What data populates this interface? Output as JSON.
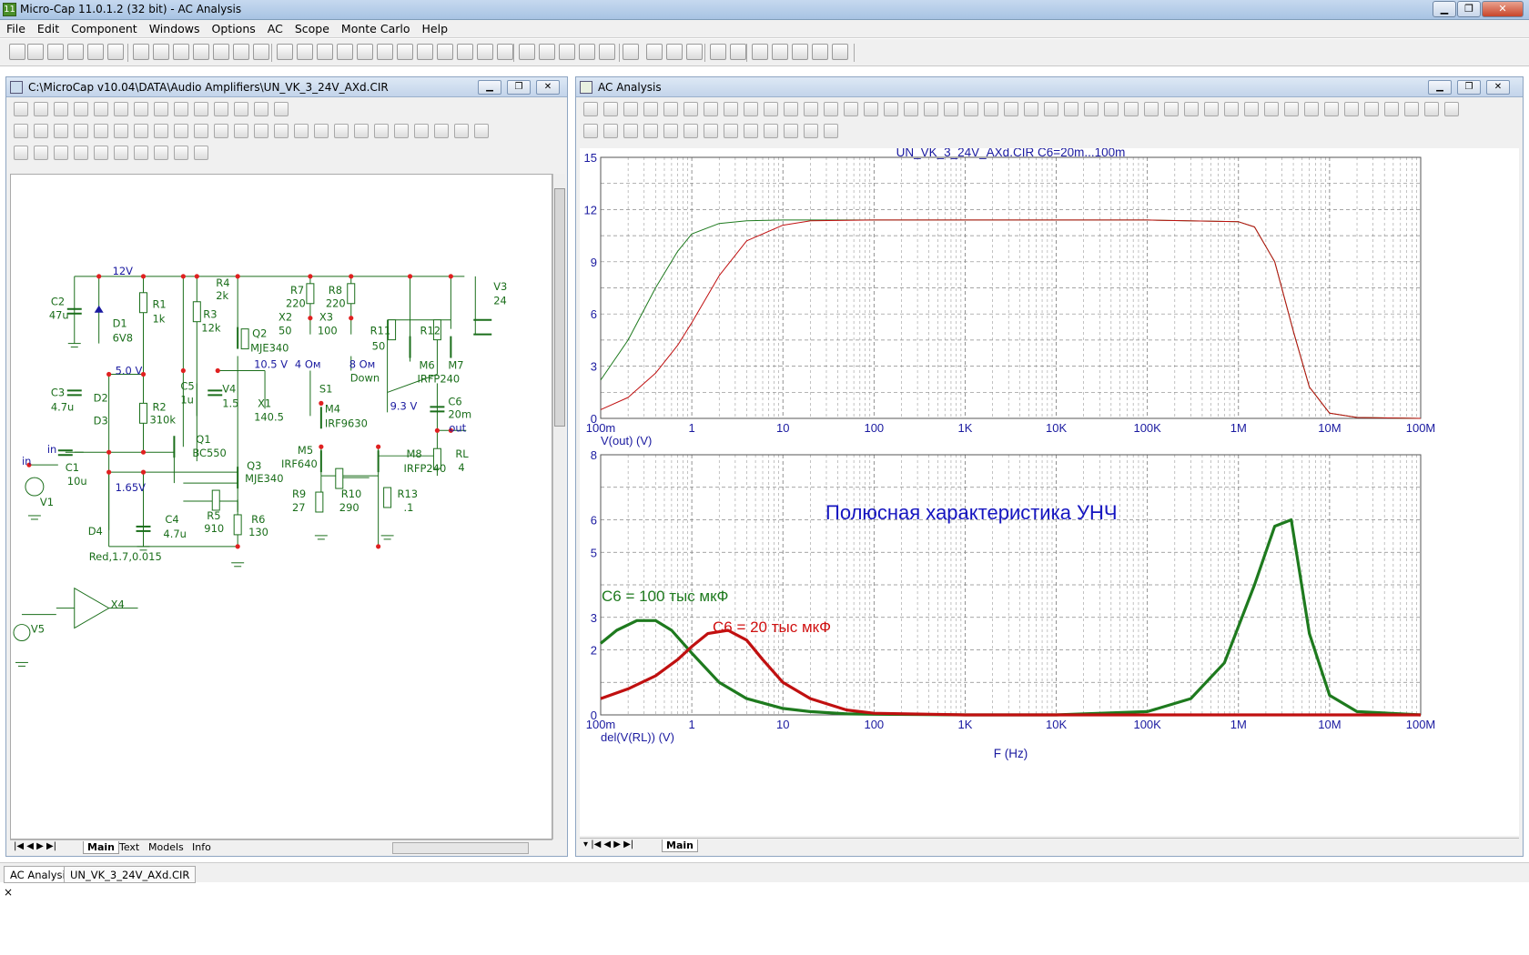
{
  "app": {
    "title": "Micro-Cap 11.0.1.2 (32 bit) - AC Analysis",
    "icon_label": "11"
  },
  "menu": [
    "File",
    "Edit",
    "Component",
    "Windows",
    "Options",
    "AC",
    "Scope",
    "Monte Carlo",
    "Help"
  ],
  "schematic": {
    "title": "C:\\MicroCap v10.04\\DATA\\Audio Amplifiers\\UN_VK_3_24V_AXd.CIR",
    "tabs": [
      "Main",
      "Text",
      "Models",
      "Info"
    ],
    "labels": [
      {
        "t": "12V",
        "c": "#1a1aa0"
      },
      {
        "t": "C2",
        "c": "#1a6e1a"
      },
      {
        "t": "47u",
        "c": "#1a6e1a"
      },
      {
        "t": "D1",
        "c": "#1a6e1a"
      },
      {
        "t": "6V8",
        "c": "#1a6e1a"
      },
      {
        "t": "R1",
        "c": "#1a6e1a"
      },
      {
        "t": "1k",
        "c": "#1a6e1a"
      },
      {
        "t": "R4",
        "c": "#1a6e1a"
      },
      {
        "t": "2k",
        "c": "#1a6e1a"
      },
      {
        "t": "R3",
        "c": "#1a6e1a"
      },
      {
        "t": "12k",
        "c": "#1a6e1a"
      },
      {
        "t": "Q2",
        "c": "#1a6e1a"
      },
      {
        "t": "MJE340",
        "c": "#1a6e1a"
      },
      {
        "t": "R7",
        "c": "#1a6e1a"
      },
      {
        "t": "220",
        "c": "#1a6e1a"
      },
      {
        "t": "R8",
        "c": "#1a6e1a"
      },
      {
        "t": "220",
        "c": "#1a6e1a"
      },
      {
        "t": "X2",
        "c": "#1a6e1a"
      },
      {
        "t": "50",
        "c": "#1a6e1a"
      },
      {
        "t": "X3",
        "c": "#1a6e1a"
      },
      {
        "t": "100",
        "c": "#1a6e1a"
      },
      {
        "t": "R11",
        "c": "#1a6e1a"
      },
      {
        "t": "50",
        "c": "#1a6e1a"
      },
      {
        "t": "R12",
        "c": "#1a6e1a"
      },
      {
        "t": "M6",
        "c": "#1a6e1a"
      },
      {
        "t": "M7",
        "c": "#1a6e1a"
      },
      {
        "t": "IRFP240",
        "c": "#1a6e1a"
      },
      {
        "t": "V3",
        "c": "#1a6e1a"
      },
      {
        "t": "24",
        "c": "#1a6e1a"
      },
      {
        "t": "5.0 V",
        "c": "#1a1aa0"
      },
      {
        "t": "10.5 V",
        "c": "#1a1aa0"
      },
      {
        "t": "4 Ом",
        "c": "#1a1aa0"
      },
      {
        "t": "8 Ом",
        "c": "#1a1aa0"
      },
      {
        "t": "Down",
        "c": "#1a6e1a"
      },
      {
        "t": "S1",
        "c": "#1a6e1a"
      },
      {
        "t": "C3",
        "c": "#1a6e1a"
      },
      {
        "t": "4.7u",
        "c": "#1a6e1a"
      },
      {
        "t": "D2",
        "c": "#1a6e1a"
      },
      {
        "t": "D3",
        "c": "#1a6e1a"
      },
      {
        "t": "R2",
        "c": "#1a6e1a"
      },
      {
        "t": "310k",
        "c": "#1a6e1a"
      },
      {
        "t": "C5",
        "c": "#1a6e1a"
      },
      {
        "t": "1u",
        "c": "#1a6e1a"
      },
      {
        "t": "V4",
        "c": "#1a6e1a"
      },
      {
        "t": "1.5",
        "c": "#1a6e1a"
      },
      {
        "t": "X1",
        "c": "#1a6e1a"
      },
      {
        "t": "140.5",
        "c": "#1a6e1a"
      },
      {
        "t": "M4",
        "c": "#1a6e1a"
      },
      {
        "t": "IRF9630",
        "c": "#1a6e1a"
      },
      {
        "t": "9.3 V",
        "c": "#1a1aa0"
      },
      {
        "t": "C6",
        "c": "#1a6e1a"
      },
      {
        "t": "20m",
        "c": "#1a6e1a"
      },
      {
        "t": "out",
        "c": "#1a1aa0"
      },
      {
        "t": "in",
        "c": "#1a1aa0"
      },
      {
        "t": "Q1",
        "c": "#1a6e1a"
      },
      {
        "t": "BC550",
        "c": "#1a6e1a"
      },
      {
        "t": "C1",
        "c": "#1a6e1a"
      },
      {
        "t": "10u",
        "c": "#1a6e1a"
      },
      {
        "t": "in",
        "c": "#1a1aa0"
      },
      {
        "t": "M5",
        "c": "#1a6e1a"
      },
      {
        "t": "IRF640",
        "c": "#1a6e1a"
      },
      {
        "t": "M8",
        "c": "#1a6e1a"
      },
      {
        "t": "IRFP240",
        "c": "#1a6e1a"
      },
      {
        "t": "RL",
        "c": "#1a6e1a"
      },
      {
        "t": "4",
        "c": "#1a6e1a"
      },
      {
        "t": "Q3",
        "c": "#1a6e1a"
      },
      {
        "t": "MJE340",
        "c": "#1a6e1a"
      },
      {
        "t": "1.65V",
        "c": "#1a1aa0"
      },
      {
        "t": "V1",
        "c": "#1a6e1a"
      },
      {
        "t": "R9",
        "c": "#1a6e1a"
      },
      {
        "t": "27",
        "c": "#1a6e1a"
      },
      {
        "t": "R10",
        "c": "#1a6e1a"
      },
      {
        "t": "290",
        "c": "#1a6e1a"
      },
      {
        "t": "R13",
        "c": "#1a6e1a"
      },
      {
        "t": ".1",
        "c": "#1a6e1a"
      },
      {
        "t": "R5",
        "c": "#1a6e1a"
      },
      {
        "t": "910",
        "c": "#1a6e1a"
      },
      {
        "t": "R6",
        "c": "#1a6e1a"
      },
      {
        "t": "130",
        "c": "#1a6e1a"
      },
      {
        "t": "D4",
        "c": "#1a6e1a"
      },
      {
        "t": "C4",
        "c": "#1a6e1a"
      },
      {
        "t": "4.7u",
        "c": "#1a6e1a"
      },
      {
        "t": "Red,1.7,0.015",
        "c": "#1a6e1a"
      },
      {
        "t": "X4",
        "c": "#1a6e1a"
      },
      {
        "t": "V5",
        "c": "#1a6e1a"
      }
    ]
  },
  "analysis": {
    "title": "AC Analysis",
    "tab": "Main",
    "colors": {
      "green": "#1e7a1e",
      "red": "#c01010",
      "axis": "#1a1aa0"
    }
  },
  "chart_data": [
    {
      "type": "line",
      "title": "UN_VK_3_24V_AXd.CIR C6=20m...100m",
      "xlabel": "",
      "ylabel": "V(out) (V)",
      "x_scale": "log",
      "xlim": [
        0.1,
        100000000
      ],
      "ylim": [
        0,
        15
      ],
      "x_ticks": [
        "100m",
        "1",
        "10",
        "100",
        "1K",
        "10K",
        "100K",
        "1M",
        "10M",
        "100M"
      ],
      "y_ticks": [
        "0",
        "3",
        "6",
        "9",
        "12",
        "15"
      ],
      "grid": true,
      "series": [
        {
          "color": "#1e7a1e",
          "x": [
            0.1,
            0.2,
            0.4,
            0.7,
            1,
            2,
            4,
            10,
            20,
            100,
            1000,
            100000,
            1000000,
            1500000,
            2500000,
            4000000,
            6000000,
            10000000,
            20000000,
            100000000
          ],
          "values": [
            2.2,
            4.5,
            7.5,
            9.6,
            10.6,
            11.2,
            11.35,
            11.4,
            11.4,
            11.4,
            11.4,
            11.4,
            11.3,
            11.0,
            9.0,
            5.0,
            1.8,
            0.3,
            0.05,
            0
          ]
        },
        {
          "color": "#c01010",
          "x": [
            0.1,
            0.2,
            0.4,
            0.7,
            1,
            2,
            4,
            10,
            20,
            100,
            1000,
            100000,
            1000000,
            1500000,
            2500000,
            4000000,
            6000000,
            10000000,
            20000000,
            100000000
          ],
          "values": [
            0.5,
            1.2,
            2.6,
            4.2,
            5.5,
            8.2,
            10.2,
            11.1,
            11.35,
            11.4,
            11.4,
            11.4,
            11.3,
            11.0,
            9.0,
            5.0,
            1.8,
            0.3,
            0.05,
            0
          ]
        }
      ]
    },
    {
      "type": "line",
      "title": "",
      "xlabel": "F (Hz)",
      "ylabel": "del(V(RL)) (V)",
      "x_scale": "log",
      "xlim": [
        0.1,
        100000000
      ],
      "ylim": [
        0,
        8
      ],
      "x_ticks": [
        "100m",
        "1",
        "10",
        "100",
        "1K",
        "10K",
        "100K",
        "1M",
        "10M",
        "100M"
      ],
      "y_ticks": [
        "0",
        "2",
        "3",
        "5",
        "6",
        "8"
      ],
      "grid": true,
      "annotations": [
        {
          "text": "Полюсная характеристика УНЧ",
          "color": "#1515c0"
        },
        {
          "text": "C6 = 100 тыс мкФ",
          "color": "#1e7a1e"
        },
        {
          "text": "C6 = 20 тыс мкФ",
          "color": "#d01010"
        }
      ],
      "series": [
        {
          "color": "#1e7a1e",
          "x": [
            0.1,
            0.15,
            0.25,
            0.4,
            0.6,
            1,
            2,
            4,
            10,
            20,
            50,
            100,
            1000,
            10000,
            100000,
            300000,
            700000,
            1500000,
            2500000,
            3800000,
            6000000,
            10000000,
            20000000,
            100000000
          ],
          "values": [
            2.2,
            2.6,
            2.9,
            2.9,
            2.6,
            1.9,
            1.0,
            0.5,
            0.2,
            0.1,
            0.03,
            0.02,
            0,
            0,
            0.1,
            0.5,
            1.6,
            4.0,
            5.8,
            6.0,
            2.5,
            0.6,
            0.1,
            0
          ]
        },
        {
          "color": "#c01010",
          "x": [
            0.1,
            0.2,
            0.4,
            0.7,
            1,
            1.5,
            2.5,
            4,
            6,
            10,
            20,
            50,
            100,
            1000,
            100000000
          ],
          "values": [
            0.5,
            0.8,
            1.2,
            1.7,
            2.1,
            2.5,
            2.6,
            2.3,
            1.7,
            1.0,
            0.5,
            0.15,
            0.05,
            0,
            0
          ]
        }
      ]
    }
  ],
  "bottom_tabs": [
    "AC Analysis",
    "UN_VK_3_24V_AXd.CIR"
  ],
  "close_mark": "×"
}
